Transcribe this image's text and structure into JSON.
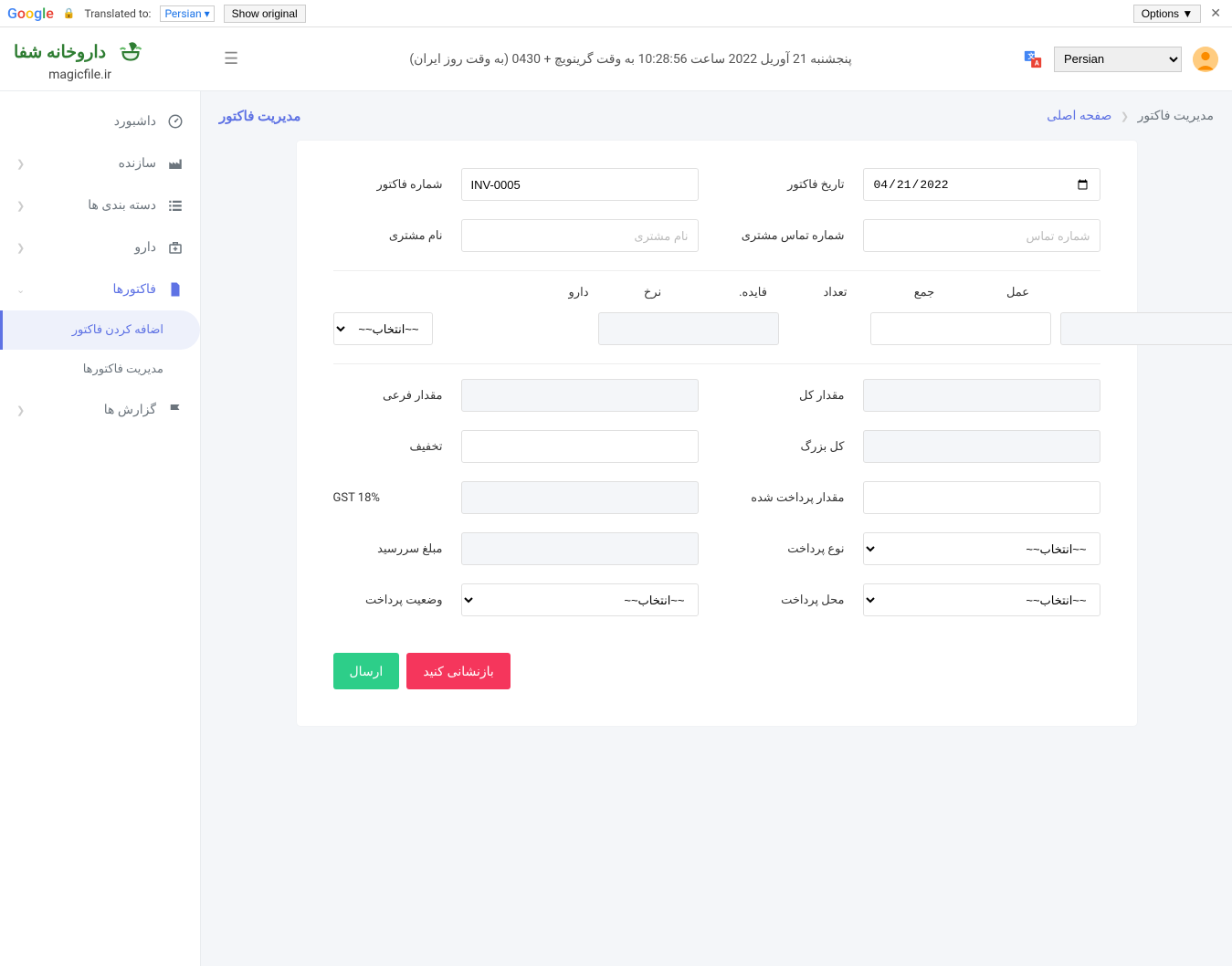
{
  "google_translate": {
    "translated_to": "Translated to:",
    "language": "Persian",
    "show_original": "Show original",
    "options": "Options ▼"
  },
  "brand": {
    "line1": "داروخانه شفا",
    "line2": "magicfile.ir"
  },
  "navbar": {
    "datetime": "پنجشنبه 21 آوریل 2022 ساعت 10:28:56 به وقت گرینویچ + 0430 (به وقت روز ایران)",
    "language": "Persian"
  },
  "sidebar": {
    "dashboard": "داشبورد",
    "manufacturer": "سازنده",
    "categories": "دسته بندی ها",
    "medicine": "دارو",
    "invoices": "فاکتورها",
    "add_invoice": "اضافه کردن فاکتور",
    "manage_invoices": "مدیریت فاکتورها",
    "reports": "گزارش ها"
  },
  "breadcrumb": {
    "home": "صفحه اصلی",
    "current": "مدیریت فاکتور",
    "title": "مدیریت فاکتور"
  },
  "form": {
    "invoice_no_label": "شماره فاکتور",
    "invoice_no_value": "INV-0005",
    "invoice_date_label": "تاریخ فاکتور",
    "invoice_date_value": "2022-04-21",
    "customer_name_label": "نام مشتری",
    "customer_name_placeholder": "نام مشتری",
    "customer_contact_label": "شماره تماس مشتری",
    "customer_contact_placeholder": "شماره تماس",
    "select_placeholder": "~~انتخاب~~",
    "subtotal_label": "مقدار فرعی",
    "total_label": "مقدار کل",
    "discount_label": "تخفیف",
    "grand_total_label": "کل بزرگ",
    "gst_label": "GST 18%",
    "paid_amount_label": "مقدار پرداخت شده",
    "due_amount_label": "مبلغ سررسید",
    "payment_type_label": "نوع پرداخت",
    "payment_status_label": "وضعیت پرداخت",
    "payment_place_label": "محل پرداخت",
    "submit": "ارسال",
    "reset": "بازنشانی کنید"
  },
  "table": {
    "drug": "دارو",
    "rate": "نرخ",
    "available": "فایده.",
    "qty": "تعداد",
    "total": "جمع",
    "action": "عمل"
  }
}
